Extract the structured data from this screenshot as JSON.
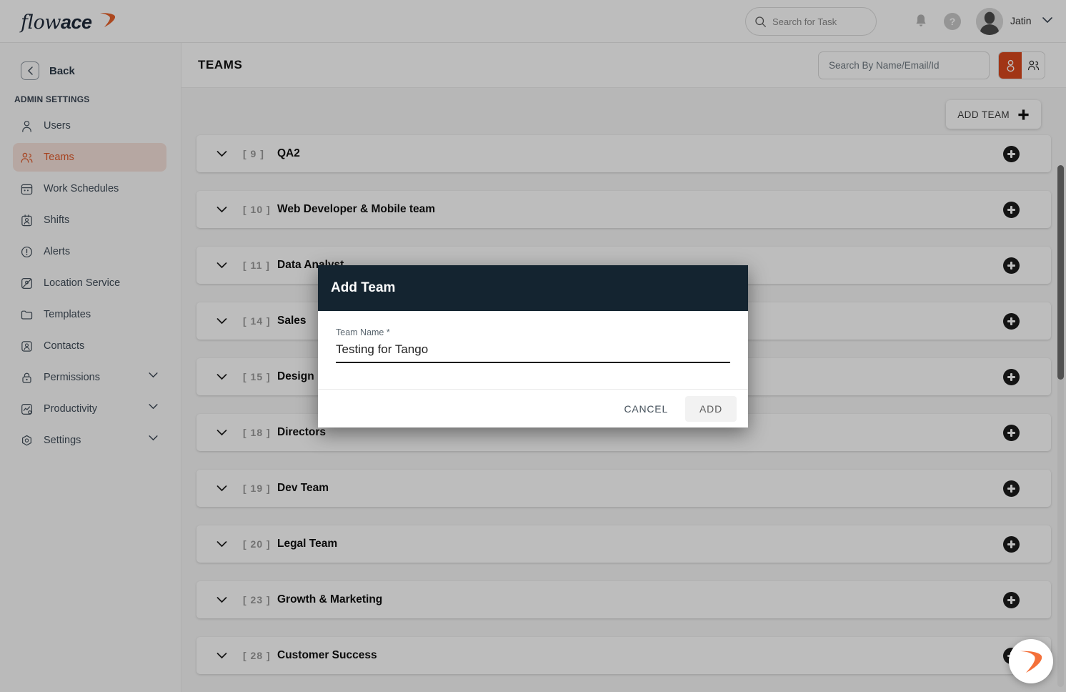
{
  "brand": {
    "name_light": "flow",
    "name_bold": "ace",
    "accent_color": "#e8622a",
    "dark_color": "#142430"
  },
  "topbar": {
    "task_search_placeholder": "Search for Task",
    "task_search_value": "",
    "help_glyph": "?",
    "user_name": "Jatin"
  },
  "sidebar": {
    "back_label": "Back",
    "section_label": "ADMIN SETTINGS",
    "items": [
      {
        "label": "Users",
        "icon": "user-icon",
        "active": false,
        "expandable": false
      },
      {
        "label": "Teams",
        "icon": "users-group-icon",
        "active": true,
        "expandable": false
      },
      {
        "label": "Work Schedules",
        "icon": "calendar-icon",
        "active": false,
        "expandable": false
      },
      {
        "label": "Shifts",
        "icon": "badge-icon",
        "active": false,
        "expandable": false
      },
      {
        "label": "Alerts",
        "icon": "alert-circle-icon",
        "active": false,
        "expandable": false
      },
      {
        "label": "Location Service",
        "icon": "map-pin-icon",
        "active": false,
        "expandable": false
      },
      {
        "label": "Templates",
        "icon": "folder-icon",
        "active": false,
        "expandable": false
      },
      {
        "label": "Contacts",
        "icon": "contact-card-icon",
        "active": false,
        "expandable": false
      },
      {
        "label": "Permissions",
        "icon": "lock-icon",
        "active": false,
        "expandable": true
      },
      {
        "label": "Productivity",
        "icon": "chart-gear-icon",
        "active": false,
        "expandable": true
      },
      {
        "label": "Settings",
        "icon": "settings-gear-icon",
        "active": false,
        "expandable": true
      }
    ]
  },
  "page": {
    "title": "TEAMS",
    "name_search_placeholder": "Search By Name/Email/Id",
    "name_search_value": "",
    "view_toggle": {
      "selected": "single-user",
      "options": [
        "single-user",
        "group-user"
      ]
    },
    "add_team_button": "ADD TEAM"
  },
  "teams": [
    {
      "index": "[ 9 ]",
      "name": "QA2"
    },
    {
      "index": "[ 10 ]",
      "name": "Web Developer & Mobile team"
    },
    {
      "index": "[ 11 ]",
      "name": "Data Analyst"
    },
    {
      "index": "[ 14 ]",
      "name": "Sales"
    },
    {
      "index": "[ 15 ]",
      "name": "Design"
    },
    {
      "index": "[ 18 ]",
      "name": "Directors"
    },
    {
      "index": "[ 19 ]",
      "name": "Dev Team"
    },
    {
      "index": "[ 20 ]",
      "name": "Legal Team"
    },
    {
      "index": "[ 23 ]",
      "name": "Growth & Marketing"
    },
    {
      "index": "[ 28 ]",
      "name": "Customer Success"
    }
  ],
  "modal": {
    "title": "Add Team",
    "field_label": "Team Name *",
    "field_value": "Testing for Tango",
    "field_placeholder": "",
    "cancel_label": "CANCEL",
    "add_label": "ADD"
  }
}
